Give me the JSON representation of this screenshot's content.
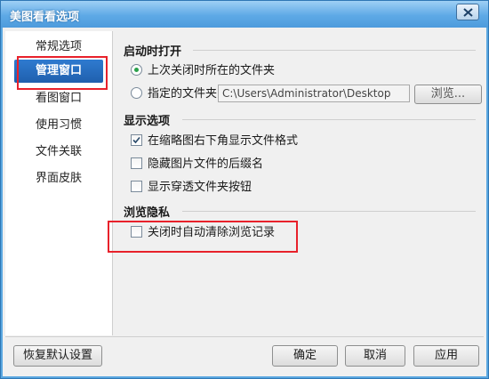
{
  "window": {
    "title": "美图看看选项"
  },
  "sidebar": {
    "items": [
      {
        "label": "常规选项",
        "active": false
      },
      {
        "label": "管理窗口",
        "active": true
      },
      {
        "label": "看图窗口",
        "active": false
      },
      {
        "label": "使用习惯",
        "active": false
      },
      {
        "label": "文件关联",
        "active": false
      },
      {
        "label": "界面皮肤",
        "active": false
      }
    ]
  },
  "startup": {
    "title": "启动时打开",
    "option_last": "上次关闭时所在的文件夹",
    "option_specified": "指定的文件夹",
    "path_value": "C:\\Users\\Administrator\\Desktop",
    "browse_label": "浏览..."
  },
  "display": {
    "title": "显示选项",
    "show_format": "在缩略图右下角显示文件格式",
    "hide_extension": "隐藏图片文件的后缀名",
    "show_through_button": "显示穿透文件夹按钮"
  },
  "privacy": {
    "title": "浏览隐私",
    "clear_history": "关闭时自动清除浏览记录"
  },
  "footer": {
    "restore_defaults": "恢复默认设置",
    "ok": "确定",
    "cancel": "取消",
    "apply": "应用"
  },
  "colors": {
    "accent": "#1f5fad",
    "highlight": "#e8212b",
    "radio_on": "#2aa04a"
  }
}
